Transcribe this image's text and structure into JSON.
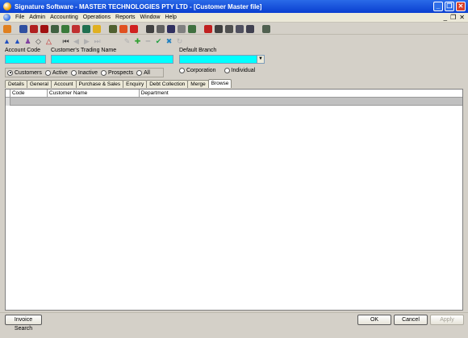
{
  "window": {
    "title": "Signature Software - MASTER TECHNOLOGIES PTY LTD - [Customer Master file]"
  },
  "menu": {
    "items": [
      "File",
      "Admin",
      "Accounting",
      "Operations",
      "Reports",
      "Window",
      "Help"
    ]
  },
  "form": {
    "account_code_label": "Account Code",
    "trading_name_label": "Customer's Trading Name",
    "default_branch_label": "Default Branch",
    "account_code_value": "",
    "trading_name_value": "",
    "default_branch_value": ""
  },
  "filters": {
    "options": [
      "Customers",
      "Active",
      "Inactive",
      "Prospects",
      "All"
    ],
    "selected": "Customers"
  },
  "entity_type": {
    "options": [
      "Corporation",
      "Individual"
    ]
  },
  "tabs": [
    "Details",
    "General",
    "Account",
    "Purchase & Sales",
    "Enquiry",
    "Debt Collection",
    "Merge",
    "Browse"
  ],
  "active_tab": "Browse",
  "grid": {
    "columns": [
      "Code",
      "Customer Name",
      "Department"
    ]
  },
  "buttons": {
    "invoice_search": "Invoice Search",
    "ok": "OK",
    "cancel": "Cancel",
    "apply": "Apply"
  },
  "colors": {
    "title_bar": "#0a3fd0",
    "field_highlight": "#00ffff"
  }
}
